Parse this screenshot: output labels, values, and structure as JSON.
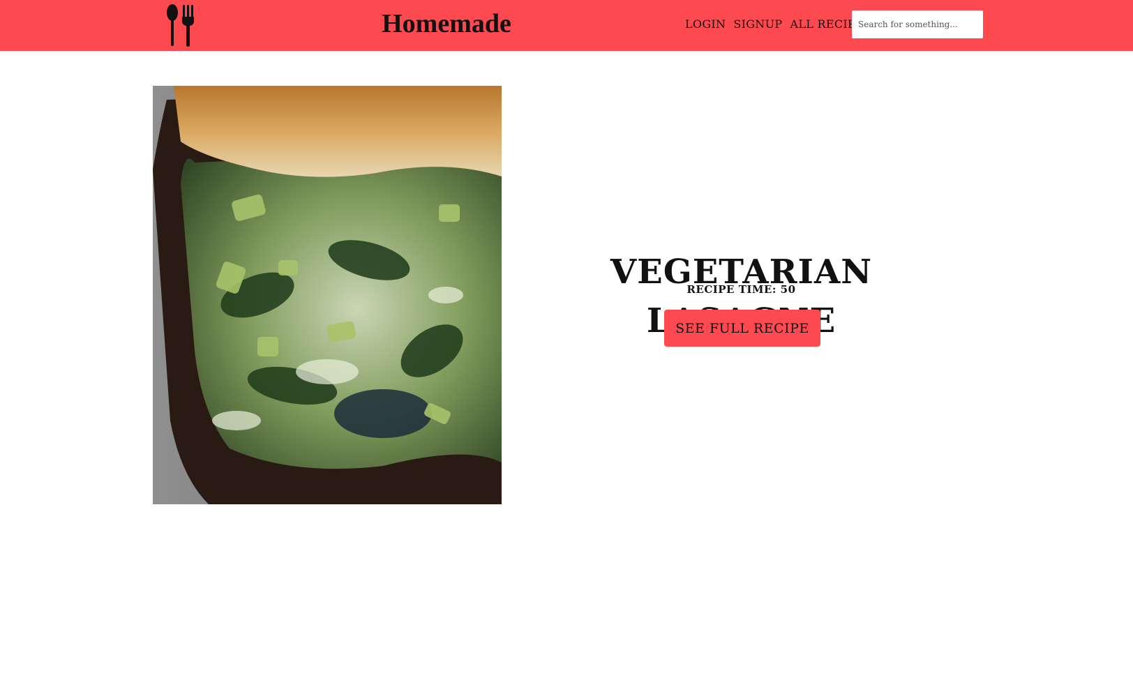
{
  "site": {
    "brand": "Homemade",
    "logo_icon": "spoon-fork-icon",
    "accent_color": "#fd4a50"
  },
  "nav": {
    "items": [
      {
        "label": "LOGIN"
      },
      {
        "label": "SIGNUP"
      },
      {
        "label": "ALL RECIPES"
      }
    ]
  },
  "search": {
    "placeholder": "Search for something...",
    "value": ""
  },
  "recipe": {
    "title": "VEGETARIAN LASAGNE",
    "time_label": "RECIPE TIME: 50",
    "button_label": "SEE FULL RECIPE",
    "image_alt": "Vegetarian lasagne"
  }
}
